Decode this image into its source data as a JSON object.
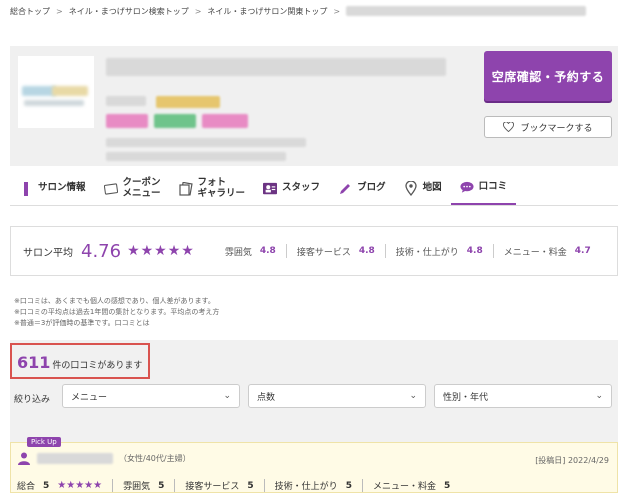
{
  "breadcrumb": [
    "総合トップ",
    "ネイル・まつげサロン検索トップ",
    "ネイル・まつげサロン関東トップ"
  ],
  "header": {
    "reserve_label": "空席確認・予約する",
    "bookmark_label": "ブックマークする"
  },
  "nav": [
    {
      "label": "サロン情報",
      "icon": "salon-icon"
    },
    {
      "label": "クーポン\nメニュー",
      "icon": "coupon-icon"
    },
    {
      "label": "フォト\nギャラリー",
      "icon": "photo-icon"
    },
    {
      "label": "スタッフ",
      "icon": "staff-icon"
    },
    {
      "label": "ブログ",
      "icon": "pen-icon"
    },
    {
      "label": "地図",
      "icon": "map-pin-icon"
    },
    {
      "label": "口コミ",
      "icon": "chat-icon"
    }
  ],
  "rating": {
    "avg_label": "サロン平均",
    "avg_value": "4.76",
    "stars": "★★★★★",
    "subs": [
      {
        "label": "雰囲気",
        "value": "4.8"
      },
      {
        "label": "接客サービス",
        "value": "4.8"
      },
      {
        "label": "技術・仕上がり",
        "value": "4.8"
      },
      {
        "label": "メニュー・料金",
        "value": "4.7"
      }
    ]
  },
  "notes": [
    "※口コミは、あくまでも個人の感想であり、個人差があります。",
    "※口コミの平均点は過去1年間の集計となります。平均点の考え方",
    "※普通＝3が評価時の基準です。口コミとは"
  ],
  "count": {
    "number": "611",
    "text": "件の口コミがあります"
  },
  "filter": {
    "label": "絞り込み",
    "selects": [
      "メニュー",
      "点数",
      "性別・年代"
    ]
  },
  "review": {
    "pickup_label": "Pick Up",
    "author_meta": "（女性/40代/主婦）",
    "date": "[投稿日] 2022/4/29",
    "overall_label": "総合",
    "overall_value": "5",
    "stars": "★★★★★",
    "subs": [
      {
        "label": "雰囲気",
        "value": "5"
      },
      {
        "label": "接客サービス",
        "value": "5"
      },
      {
        "label": "技術・仕上がり",
        "value": "5"
      },
      {
        "label": "メニュー・料金",
        "value": "5"
      }
    ]
  },
  "colors": {
    "accent": "#8e44ad",
    "highlight": "#d9534f"
  }
}
